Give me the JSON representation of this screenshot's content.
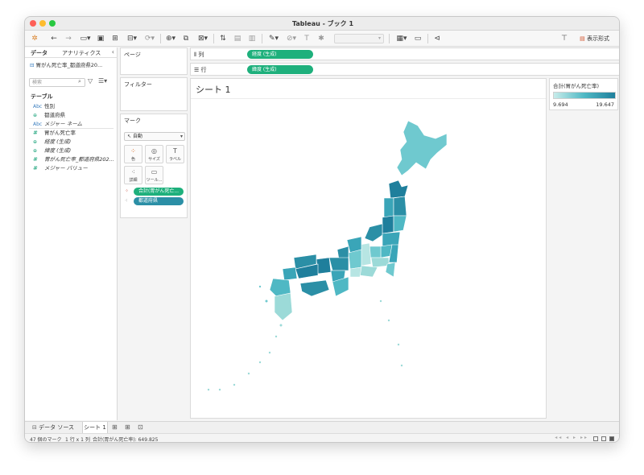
{
  "window": {
    "title": "Tableau - ブック 1"
  },
  "toolbar": {
    "show_me": "表示形式"
  },
  "data_pane": {
    "tab_data": "データ",
    "tab_analytics": "アナリティクス",
    "datasource": "胃がん死亡率_都道府県20...",
    "search_placeholder": "検索",
    "section": "テーブル",
    "fields": [
      {
        "icon": "Abc",
        "name": "性別"
      },
      {
        "icon": "globe",
        "name": "都道府県"
      },
      {
        "icon": "Abc",
        "name": "メジャー ネーム"
      },
      {
        "icon": "#",
        "name": "胃がん死亡率"
      },
      {
        "icon": "globe",
        "name": "経度 (生成)"
      },
      {
        "icon": "globe",
        "name": "緯度 (生成)"
      },
      {
        "icon": "#",
        "name": "胃がん死亡率_都道府県202..."
      },
      {
        "icon": "#",
        "name": "メジャー バリュー"
      }
    ]
  },
  "cards": {
    "pages": "ページ",
    "filters": "フィルター",
    "marks": "マーク",
    "mark_type": "自動",
    "buttons": {
      "color": "色",
      "size": "サイズ",
      "label": "ラベル",
      "detail": "詳細",
      "tooltip": "ツール..."
    },
    "pill_color": "合計(胃がん死亡...",
    "pill_detail": "都道府県"
  },
  "shelves": {
    "columns_label": "列",
    "columns_pill": "経度 (生成)",
    "rows_label": "行",
    "rows_pill": "緯度 (生成)"
  },
  "sheet": {
    "title": "シート 1"
  },
  "legend": {
    "title": "合計(胃がん死亡率)",
    "min": "9.694",
    "max": "19.647",
    "colors": [
      "#c8ecea",
      "#4fb8c4",
      "#1f7f9c"
    ]
  },
  "bottom_tabs": {
    "data_source": "データ ソース",
    "sheet": "シート 1"
  },
  "status": {
    "marks": "47 個のマーク",
    "dims": "1 行 x 1 列",
    "sum": "合計(胃がん死亡率): 649.825"
  }
}
